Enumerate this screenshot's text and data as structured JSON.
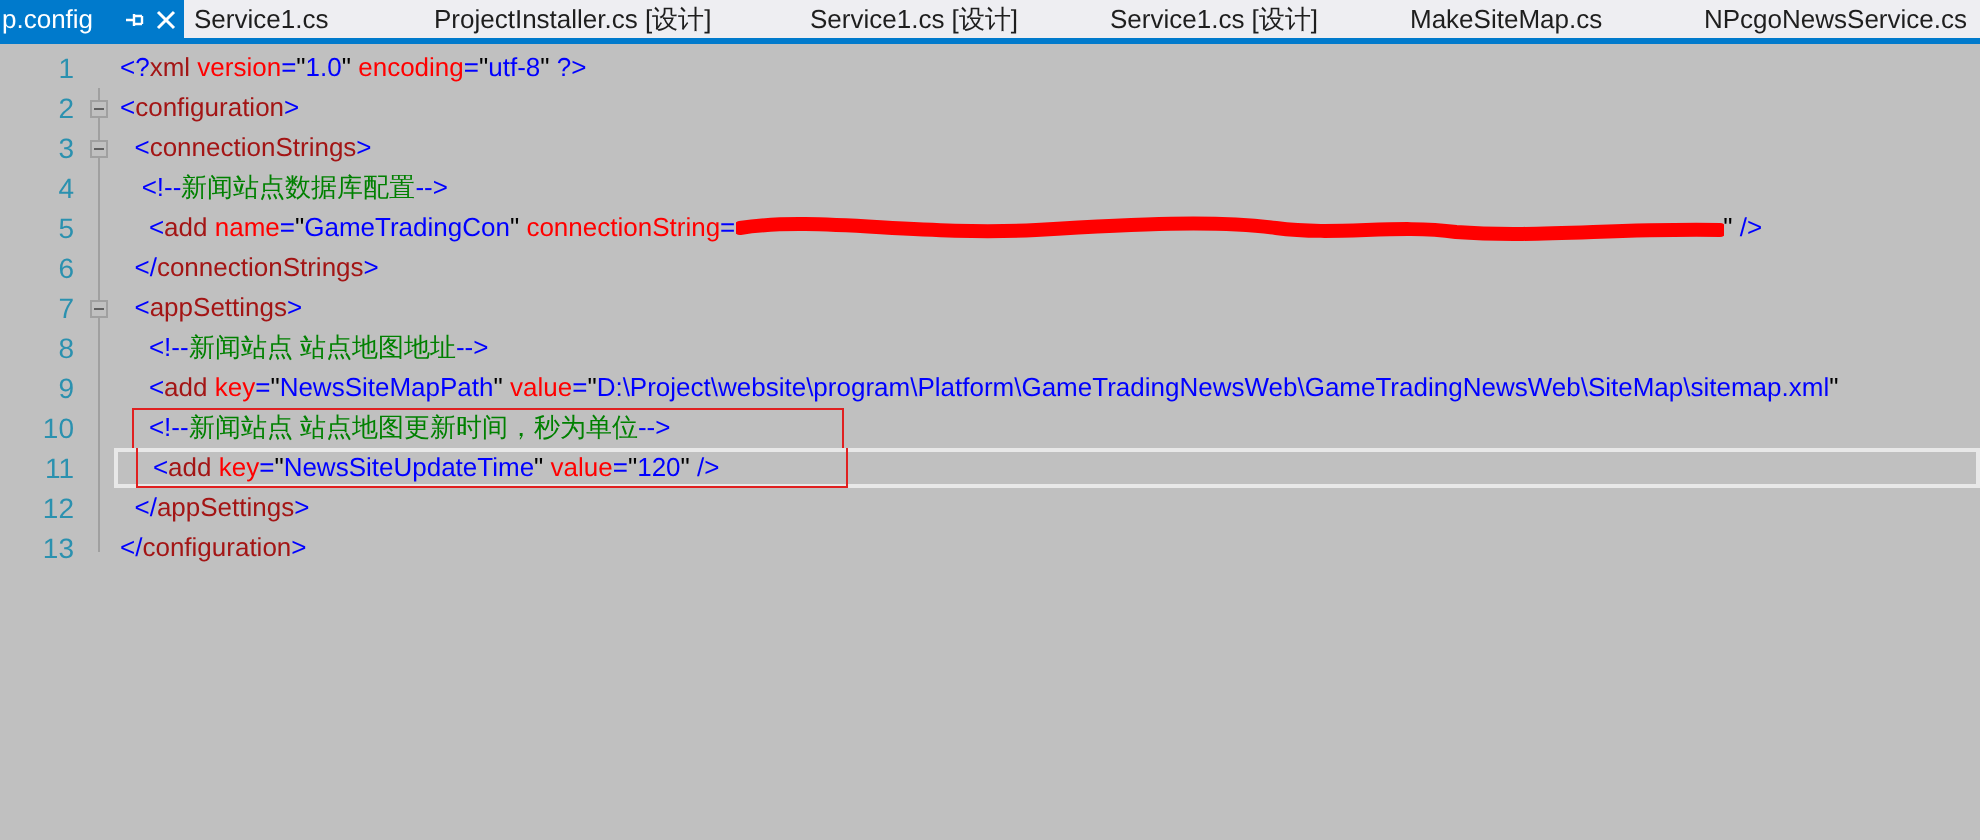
{
  "tabs": [
    {
      "label": "p.config",
      "selected": true
    },
    {
      "label": "Service1.cs",
      "selected": false
    },
    {
      "label": "ProjectInstaller.cs [设计]",
      "selected": false
    },
    {
      "label": "Service1.cs [设计]",
      "selected": false
    },
    {
      "label": "Service1.cs [设计]",
      "selected": false
    },
    {
      "label": "MakeSiteMap.cs",
      "selected": false
    },
    {
      "label": "NPcgoNewsService.cs",
      "selected": false
    }
  ],
  "editor": {
    "lines": [
      {
        "number": "1",
        "current": false,
        "boxed": false,
        "tokens": [
          {
            "kind": "delim",
            "text": "<?"
          },
          {
            "kind": "tag",
            "text": "xml"
          },
          {
            "kind": "attr",
            "text": " version"
          },
          {
            "kind": "delim",
            "text": "="
          },
          {
            "kind": "quote",
            "text": "\""
          },
          {
            "kind": "value",
            "text": "1.0"
          },
          {
            "kind": "quote",
            "text": "\""
          },
          {
            "kind": "attr",
            "text": " encoding"
          },
          {
            "kind": "delim",
            "text": "="
          },
          {
            "kind": "quote",
            "text": "\""
          },
          {
            "kind": "value",
            "text": "utf-8"
          },
          {
            "kind": "quote",
            "text": "\""
          },
          {
            "kind": "delim",
            "text": " ?>"
          }
        ]
      },
      {
        "number": "2",
        "fold": true,
        "current": false,
        "boxed": false,
        "tokens": [
          {
            "kind": "delim",
            "text": "<"
          },
          {
            "kind": "tag",
            "text": "configuration"
          },
          {
            "kind": "delim",
            "text": ">"
          }
        ]
      },
      {
        "number": "3",
        "fold": true,
        "current": false,
        "boxed": false,
        "tokens": [
          {
            "kind": "delim",
            "text": "  <"
          },
          {
            "kind": "tag",
            "text": "connectionStrings"
          },
          {
            "kind": "delim",
            "text": ">"
          }
        ]
      },
      {
        "number": "4",
        "fold": false,
        "current": false,
        "boxed": false,
        "tokens": [
          {
            "kind": "delim",
            "text": "   <!--"
          },
          {
            "kind": "comment",
            "text": "新闻站点数据库配置"
          },
          {
            "kind": "delim",
            "text": "-->"
          }
        ]
      },
      {
        "number": "5",
        "fold": false,
        "current": false,
        "boxed": false,
        "tokens": [
          {
            "kind": "delim",
            "text": "    <"
          },
          {
            "kind": "tag",
            "text": "add"
          },
          {
            "kind": "attr",
            "text": " name"
          },
          {
            "kind": "delim",
            "text": "="
          },
          {
            "kind": "quote",
            "text": "\""
          },
          {
            "kind": "value",
            "text": "GameTradingCon"
          },
          {
            "kind": "quote",
            "text": "\""
          },
          {
            "kind": "attr",
            "text": " connectionString"
          },
          {
            "kind": "delim",
            "text": "="
          },
          {
            "kind": "redacted"
          },
          {
            "kind": "quote",
            "text": "\""
          },
          {
            "kind": "delim",
            "text": " />"
          }
        ]
      },
      {
        "number": "6",
        "fold": false,
        "current": false,
        "boxed": false,
        "tokens": [
          {
            "kind": "delim",
            "text": "  </"
          },
          {
            "kind": "tag",
            "text": "connectionStrings"
          },
          {
            "kind": "delim",
            "text": ">"
          }
        ]
      },
      {
        "number": "7",
        "fold": true,
        "current": false,
        "boxed": false,
        "tokens": [
          {
            "kind": "delim",
            "text": "  <"
          },
          {
            "kind": "tag",
            "text": "appSettings"
          },
          {
            "kind": "delim",
            "text": ">"
          }
        ]
      },
      {
        "number": "8",
        "fold": false,
        "current": false,
        "boxed": false,
        "tokens": [
          {
            "kind": "delim",
            "text": "    <!--"
          },
          {
            "kind": "comment",
            "text": "新闻站点 站点地图地址"
          },
          {
            "kind": "delim",
            "text": "-->"
          }
        ]
      },
      {
        "number": "9",
        "fold": false,
        "current": false,
        "boxed": false,
        "tokens": [
          {
            "kind": "delim",
            "text": "    <"
          },
          {
            "kind": "tag",
            "text": "add"
          },
          {
            "kind": "attr",
            "text": " key"
          },
          {
            "kind": "delim",
            "text": "="
          },
          {
            "kind": "quote",
            "text": "\""
          },
          {
            "kind": "value",
            "text": "NewsSiteMapPath"
          },
          {
            "kind": "quote",
            "text": "\""
          },
          {
            "kind": "attr",
            "text": " value"
          },
          {
            "kind": "delim",
            "text": "="
          },
          {
            "kind": "quote",
            "text": "\""
          },
          {
            "kind": "value",
            "text": "D:\\Project\\website\\program\\Platform\\GameTradingNewsWeb\\GameTradingNewsWeb\\SiteMap\\sitemap.xml"
          },
          {
            "kind": "quote",
            "text": "\""
          }
        ]
      },
      {
        "number": "10",
        "fold": false,
        "current": false,
        "boxed": true,
        "tokens": [
          {
            "kind": "delim",
            "text": "    <!--"
          },
          {
            "kind": "comment",
            "text": "新闻站点 站点地图更新时间，秒为单位"
          },
          {
            "kind": "delim",
            "text": "-->"
          }
        ]
      },
      {
        "number": "11",
        "fold": false,
        "current": true,
        "boxed": true,
        "tokens": [
          {
            "kind": "delim",
            "text": "    <"
          },
          {
            "kind": "tag",
            "text": "add"
          },
          {
            "kind": "attr",
            "text": " key"
          },
          {
            "kind": "delim",
            "text": "="
          },
          {
            "kind": "quote",
            "text": "\""
          },
          {
            "kind": "value",
            "text": "NewsSiteUpdateTime"
          },
          {
            "kind": "quote",
            "text": "\""
          },
          {
            "kind": "attr",
            "text": " value"
          },
          {
            "kind": "delim",
            "text": "="
          },
          {
            "kind": "quote",
            "text": "\""
          },
          {
            "kind": "value",
            "text": "120"
          },
          {
            "kind": "quote",
            "text": "\""
          },
          {
            "kind": "delim",
            "text": " />"
          }
        ]
      },
      {
        "number": "12",
        "fold": false,
        "current": false,
        "boxed": false,
        "tokens": [
          {
            "kind": "delim",
            "text": "  </"
          },
          {
            "kind": "tag",
            "text": "appSettings"
          },
          {
            "kind": "delim",
            "text": ">"
          }
        ]
      },
      {
        "number": "13",
        "fold": false,
        "current": false,
        "boxed": false,
        "tokens": [
          {
            "kind": "delim",
            "text": "</"
          },
          {
            "kind": "tag",
            "text": "configuration"
          },
          {
            "kind": "delim",
            "text": ">"
          }
        ]
      }
    ]
  }
}
